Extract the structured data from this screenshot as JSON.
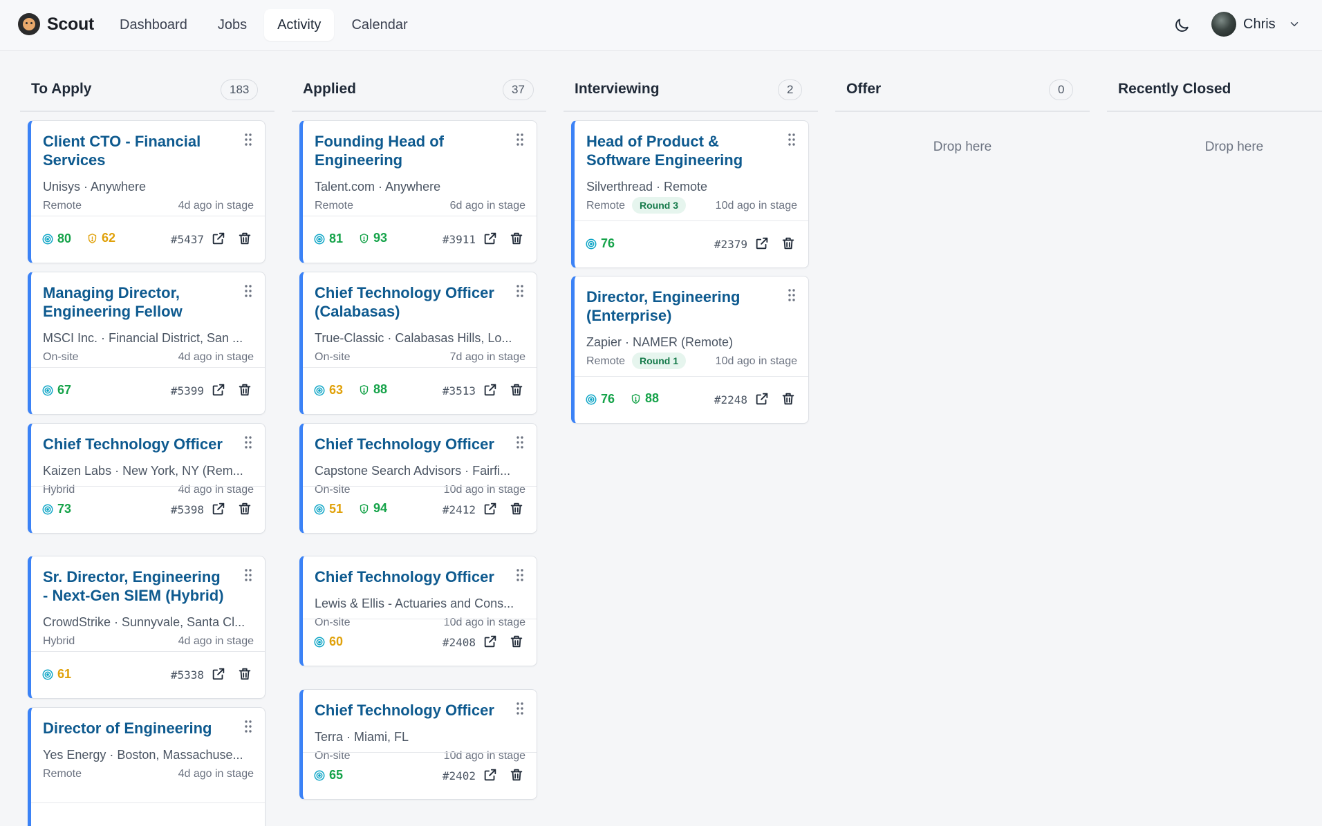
{
  "app": {
    "name": "Scout"
  },
  "nav": [
    {
      "label": "Dashboard"
    },
    {
      "label": "Jobs"
    },
    {
      "label": "Activity",
      "active": true
    },
    {
      "label": "Calendar"
    }
  ],
  "user": {
    "name": "Chris"
  },
  "colors": {
    "accent": "#3b82f6",
    "title": "#0e5a8f",
    "score_high": "#16a34a",
    "score_mid": "#e0a10a"
  },
  "columns": [
    {
      "title": "To Apply",
      "count": "183",
      "cards": [
        {
          "title": "Client CTO - Financial Services",
          "company_location": "Unisys · Anywhere",
          "work_mode": "Remote",
          "age": "4d ago in stage",
          "score": "80",
          "score_color": "green",
          "fit": "62",
          "fit_color": "amber",
          "id": "#5437"
        },
        {
          "title": "Managing Director, Engineering Fellow",
          "company_location": "MSCI Inc. · Financial District, San ...",
          "work_mode": "On-site",
          "age": "4d ago in stage",
          "score": "67",
          "score_color": "green",
          "id": "#5399"
        },
        {
          "title": "Chief Technology Officer",
          "company_location": "Kaizen Labs · New York, NY (Rem...",
          "work_mode": "Hybrid",
          "age": "4d ago in stage",
          "score": "73",
          "score_color": "green",
          "id": "#5398"
        },
        {
          "title": "Sr. Director, Engineering - Next-Gen SIEM (Hybrid)",
          "company_location": "CrowdStrike · Sunnyvale, Santa Cl...",
          "work_mode": "Hybrid",
          "age": "4d ago in stage",
          "score": "61",
          "score_color": "amber",
          "id": "#5338"
        },
        {
          "title": "Director of Engineering",
          "company_location": "Yes Energy · Boston, Massachuse...",
          "work_mode": "Remote",
          "age": "4d ago in stage"
        }
      ]
    },
    {
      "title": "Applied",
      "count": "37",
      "cards": [
        {
          "title": "Founding Head of Engineering",
          "company_location": "Talent.com · Anywhere",
          "work_mode": "Remote",
          "age": "6d ago in stage",
          "score": "81",
          "score_color": "green",
          "fit": "93",
          "fit_color": "green",
          "id": "#3911"
        },
        {
          "title": "Chief Technology Officer (Calabasas)",
          "company_location": "True-Classic · Calabasas Hills, Lo...",
          "work_mode": "On-site",
          "age": "7d ago in stage",
          "score": "63",
          "score_color": "amber",
          "fit": "88",
          "fit_color": "green",
          "id": "#3513"
        },
        {
          "title": "Chief Technology Officer",
          "company_location": "Capstone Search Advisors · Fairfi...",
          "work_mode": "On-site",
          "age": "10d ago in stage",
          "score": "51",
          "score_color": "amber",
          "fit": "94",
          "fit_color": "green",
          "id": "#2412"
        },
        {
          "title": "Chief Technology Officer",
          "company_location": "Lewis & Ellis - Actuaries and Cons...",
          "work_mode": "On-site",
          "age": "10d ago in stage",
          "score": "60",
          "score_color": "amber",
          "id": "#2408"
        },
        {
          "title": "Chief Technology Officer",
          "company_location": "Terra · Miami, FL",
          "work_mode": "On-site",
          "age": "10d ago in stage",
          "score": "65",
          "score_color": "green",
          "id": "#2402"
        }
      ]
    },
    {
      "title": "Interviewing",
      "count": "2",
      "cards": [
        {
          "title": "Head of Product & Software Engineering",
          "company_location": "Silverthread · Remote",
          "work_mode": "Remote",
          "round": "Round 3",
          "age": "10d ago in stage",
          "score": "76",
          "score_color": "green",
          "id": "#2379"
        },
        {
          "title": "Director, Engineering (Enterprise)",
          "company_location": "Zapier · NAMER (Remote)",
          "work_mode": "Remote",
          "round": "Round 1",
          "age": "10d ago in stage",
          "score": "76",
          "score_color": "green",
          "fit": "88",
          "fit_color": "green",
          "id": "#2248"
        }
      ]
    },
    {
      "title": "Offer",
      "count": "0",
      "empty_label": "Drop here",
      "cards": []
    },
    {
      "title": "Recently Closed",
      "empty_label": "Drop here",
      "cards": []
    }
  ]
}
